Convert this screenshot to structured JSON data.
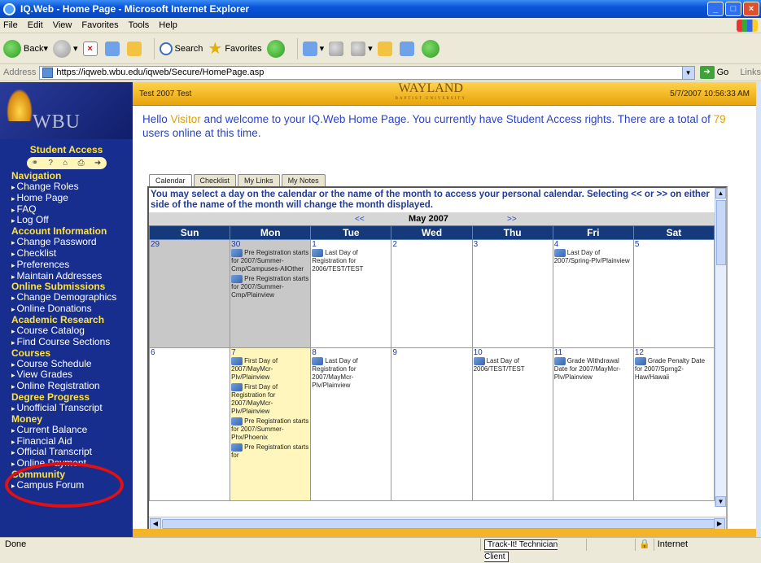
{
  "window": {
    "title": "IQ.Web - Home Page - Microsoft Internet Explorer",
    "controls": [
      "_",
      "□",
      "×"
    ]
  },
  "menu": [
    "File",
    "Edit",
    "View",
    "Favorites",
    "Tools",
    "Help"
  ],
  "toolbar": {
    "back_label": "Back",
    "search_label": "Search",
    "favorites_label": "Favorites"
  },
  "address": {
    "label": "Address",
    "url": "https://iqweb.wbu.edu/iqweb/Secure/HomePage.asp",
    "go_label": "Go",
    "links_label": "Links"
  },
  "sidebar": {
    "logo_text": "WBU",
    "access_title": "Student Access",
    "sections": [
      {
        "title": "Navigation",
        "items": [
          "Change Roles",
          "Home Page",
          "FAQ",
          "Log Off"
        ]
      },
      {
        "title": "Account Information",
        "items": [
          "Change Password",
          "Checklist",
          "Preferences",
          "Maintain Addresses"
        ]
      },
      {
        "title": "Online Submissions",
        "items": [
          "Change Demographics",
          "Online Donations"
        ]
      },
      {
        "title": "Academic Research",
        "items": [
          "Course Catalog",
          "Find Course Sections"
        ]
      },
      {
        "title": "Courses",
        "items": [
          "Course Schedule",
          "View Grades",
          "Online Registration"
        ]
      },
      {
        "title": "Degree Progress",
        "items": [
          "Unofficial Transcript"
        ]
      },
      {
        "title": "Money",
        "items": [
          "Current Balance",
          "Financial Aid",
          "Official Transcript",
          "Online Payment"
        ]
      },
      {
        "title": "Community",
        "items": [
          "Campus Forum"
        ]
      }
    ]
  },
  "header": {
    "user": "Test 2007 Test",
    "brand": "WAYLAND",
    "brand_sub": "BAPTIST UNIVERSITY",
    "datetime": "5/7/2007 10:56:33 AM"
  },
  "welcome": {
    "prefix": "Hello ",
    "name": "Visitor",
    "middle": " and welcome to your IQ.Web Home Page. You currently have Student Access rights. There are a total of ",
    "count": "79",
    "suffix": " users online at this time."
  },
  "tabs": [
    "Calendar",
    "Checklist",
    "My Links",
    "My Notes"
  ],
  "calendar": {
    "notice": "You may select a day on the calendar or the name of the month to access your personal calendar. Selecting << or >> on either side of the name of the month will change the month displayed.",
    "prev": "<<",
    "month": "May 2007",
    "next": ">>",
    "days": [
      "Sun",
      "Mon",
      "Tue",
      "Wed",
      "Thu",
      "Fri",
      "Sat"
    ],
    "weeks": [
      [
        {
          "day": "29",
          "events": []
        },
        {
          "day": "30",
          "events": [
            "Pre Registration starts for 2007/Summer-Cmp/Campuses-AllOther",
            "Pre Registration starts for 2007/Summer-Cmp/Plainview"
          ]
        },
        {
          "day": "1",
          "events": [
            "Last Day of Registration for 2006/TEST/TEST"
          ]
        },
        {
          "day": "2",
          "events": []
        },
        {
          "day": "3",
          "events": []
        },
        {
          "day": "4",
          "events": [
            "Last Day of 2007/Spring-Plv/Plainview"
          ]
        },
        {
          "day": "5",
          "events": []
        }
      ],
      [
        {
          "day": "6",
          "events": []
        },
        {
          "day": "7",
          "events": [
            "First Day of 2007/MayMcr-Plv/Plainview",
            "First Day of Registration for 2007/MayMcr-Plv/Plainview",
            "Pre Registration starts for 2007/Summer-Phx/Phoenix",
            "Pre Registration starts for"
          ]
        },
        {
          "day": "8",
          "events": [
            "Last Day of Registration for 2007/MayMcr-Plv/Plainview"
          ]
        },
        {
          "day": "9",
          "events": []
        },
        {
          "day": "10",
          "events": [
            "Last Day of 2006/TEST/TEST"
          ]
        },
        {
          "day": "11",
          "events": [
            "Grade Withdrawal Date for 2007/MayMcr-Plv/Plainview"
          ]
        },
        {
          "day": "12",
          "events": [
            "Grade Penalty Date for 2007/Sprng2-Haw/Hawaii"
          ]
        }
      ]
    ]
  },
  "status": {
    "text": "Done",
    "tracker": "Track-It! Technician Client",
    "zone": "Internet"
  }
}
